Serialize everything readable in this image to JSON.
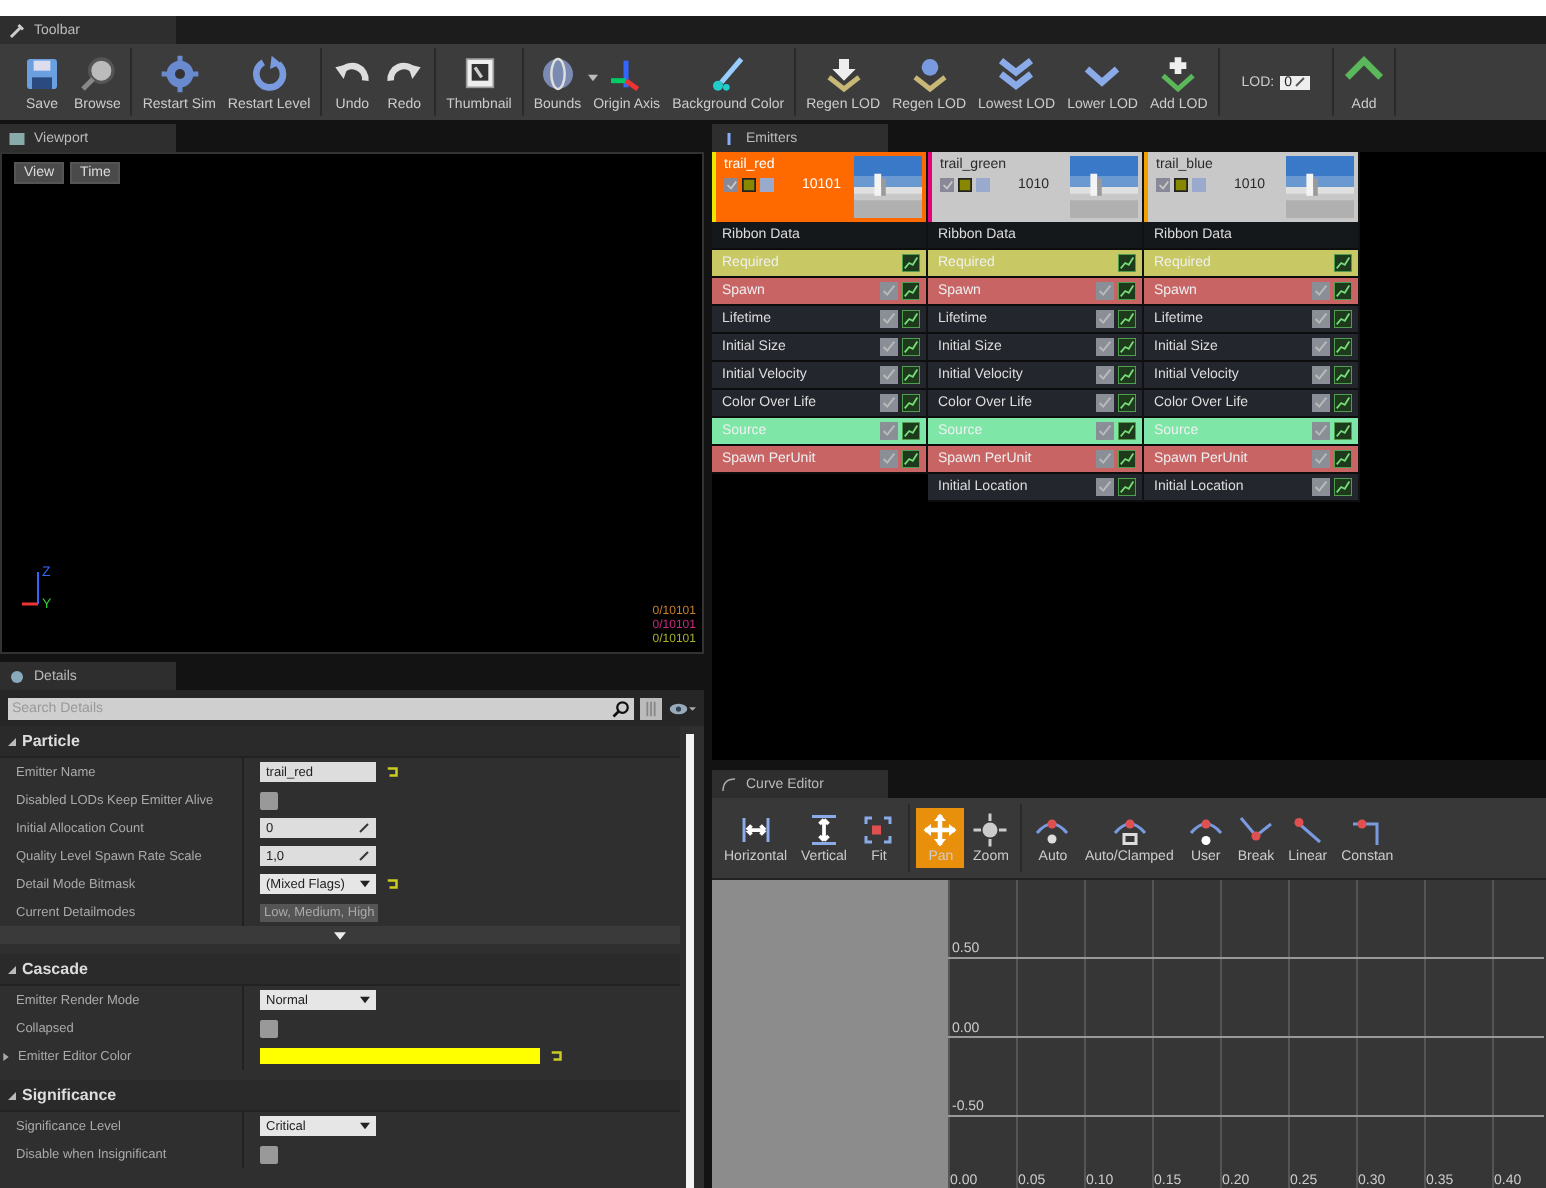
{
  "toolbar_tab": {
    "title": "Toolbar"
  },
  "toolbar": {
    "groups": [
      [
        {
          "label": "Save"
        },
        {
          "label": "Browse"
        }
      ],
      [
        {
          "label": "Restart Sim"
        },
        {
          "label": "Restart Level"
        }
      ],
      [
        {
          "label": "Undo"
        },
        {
          "label": "Redo"
        }
      ],
      [
        {
          "label": "Thumbnail"
        }
      ],
      [
        {
          "label": "Bounds",
          "dropdown": true
        },
        {
          "label": "Origin Axis"
        },
        {
          "label": "Background Color"
        }
      ],
      [
        {
          "label": "Regen LOD"
        },
        {
          "label": "Regen LOD"
        },
        {
          "label": "Lowest LOD"
        },
        {
          "label": "Lower LOD"
        },
        {
          "label": "Add LOD"
        }
      ],
      [
        {
          "label": "LOD:",
          "kind": "lod",
          "value": "0"
        }
      ],
      [
        {
          "label": "Add"
        }
      ]
    ]
  },
  "viewport": {
    "title": "Viewport",
    "buttons": [
      "View",
      "Time"
    ],
    "axis_labels": [
      "Z",
      "Y"
    ],
    "stats": [
      {
        "text": "0/10101",
        "color": "#c8802c"
      },
      {
        "text": "0/10101",
        "color": "#c82a84"
      },
      {
        "text": "0/10101",
        "color": "#a8b02a"
      }
    ]
  },
  "details": {
    "title": "Details",
    "search": {
      "placeholder": "Search Details"
    },
    "sections": [
      {
        "title": "Particle",
        "expanded": true,
        "advanced": true,
        "rows": [
          {
            "label": "Emitter Name",
            "kind": "text",
            "value": "trail_red",
            "reset": true
          },
          {
            "label": "Disabled LODs Keep Emitter Alive",
            "kind": "checkbox",
            "checked": false
          },
          {
            "label": "Initial Allocation Count",
            "kind": "number",
            "value": "0"
          },
          {
            "label": "Quality Level Spawn Rate Scale",
            "kind": "number",
            "value": "1,0"
          },
          {
            "label": "Detail Mode Bitmask",
            "kind": "dropdown",
            "value": "(Mixed Flags)",
            "reset": true
          },
          {
            "label": "Current Detailmodes",
            "kind": "readonly",
            "value": "Low, Medium, High"
          }
        ]
      },
      {
        "title": "Cascade",
        "expanded": true,
        "rows": [
          {
            "label": "Emitter Render Mode",
            "kind": "dropdown",
            "value": "Normal"
          },
          {
            "label": "Collapsed",
            "kind": "checkbox",
            "checked": false
          },
          {
            "label": "Emitter Editor Color",
            "kind": "color",
            "color": "#ffff00",
            "reset": true,
            "expandable": true
          }
        ]
      },
      {
        "title": "Significance",
        "expanded": true,
        "rows": [
          {
            "label": "Significance Level",
            "kind": "dropdown",
            "value": "Critical"
          },
          {
            "label": "Disable when Insignificant",
            "kind": "checkbox",
            "checked": false
          }
        ]
      }
    ]
  },
  "emitters": {
    "title": "Emitters",
    "columns": [
      {
        "name": "trail_red",
        "selected": true,
        "color": "#e8e800",
        "count": "10101",
        "modules": [
          {
            "label": "Ribbon Data",
            "kind": "typedata",
            "color": "#15181b"
          },
          {
            "label": "Required",
            "kind": "required",
            "color": "#c8c864"
          },
          {
            "label": "Spawn",
            "kind": "module",
            "color": "#c86464"
          },
          {
            "label": "Lifetime",
            "kind": "module",
            "color": "#24262d"
          },
          {
            "label": "Initial Size",
            "kind": "module",
            "color": "#24262d"
          },
          {
            "label": "Initial Velocity",
            "kind": "module",
            "color": "#24262d"
          },
          {
            "label": "Color Over Life",
            "kind": "module",
            "color": "#24262d"
          },
          {
            "label": "Source",
            "kind": "module",
            "color": "#7ee6a6"
          },
          {
            "label": "Spawn PerUnit",
            "kind": "module",
            "color": "#c86464"
          }
        ]
      },
      {
        "name": "trail_green",
        "selected": false,
        "color": "#e8007a",
        "count": "1010",
        "modules": [
          {
            "label": "Ribbon Data",
            "kind": "typedata",
            "color": "#15181b"
          },
          {
            "label": "Required",
            "kind": "required",
            "color": "#c8c864"
          },
          {
            "label": "Spawn",
            "kind": "module",
            "color": "#c86464"
          },
          {
            "label": "Lifetime",
            "kind": "module",
            "color": "#24262d"
          },
          {
            "label": "Initial Size",
            "kind": "module",
            "color": "#24262d"
          },
          {
            "label": "Initial Velocity",
            "kind": "module",
            "color": "#24262d"
          },
          {
            "label": "Color Over Life",
            "kind": "module",
            "color": "#24262d"
          },
          {
            "label": "Source",
            "kind": "module",
            "color": "#7ee6a6"
          },
          {
            "label": "Spawn PerUnit",
            "kind": "module",
            "color": "#c86464"
          },
          {
            "label": "Initial Location",
            "kind": "module",
            "color": "#24262d"
          }
        ]
      },
      {
        "name": "trail_blue",
        "selected": false,
        "color": "#f0a000",
        "count": "1010",
        "modules": [
          {
            "label": "Ribbon Data",
            "kind": "typedata",
            "color": "#15181b"
          },
          {
            "label": "Required",
            "kind": "required",
            "color": "#c8c864"
          },
          {
            "label": "Spawn",
            "kind": "module",
            "color": "#c86464"
          },
          {
            "label": "Lifetime",
            "kind": "module",
            "color": "#24262d"
          },
          {
            "label": "Initial Size",
            "kind": "module",
            "color": "#24262d"
          },
          {
            "label": "Initial Velocity",
            "kind": "module",
            "color": "#24262d"
          },
          {
            "label": "Color Over Life",
            "kind": "module",
            "color": "#24262d"
          },
          {
            "label": "Source",
            "kind": "module",
            "color": "#7ee6a6"
          },
          {
            "label": "Spawn PerUnit",
            "kind": "module",
            "color": "#c86464"
          },
          {
            "label": "Initial Location",
            "kind": "module",
            "color": "#24262d"
          }
        ]
      }
    ]
  },
  "curve_editor": {
    "title": "Curve Editor",
    "tools": [
      [
        {
          "label": "Horizontal",
          "selected": false
        },
        {
          "label": "Vertical",
          "selected": false
        },
        {
          "label": "Fit",
          "selected": false
        }
      ],
      [
        {
          "label": "Pan",
          "selected": true
        },
        {
          "label": "Zoom",
          "selected": false
        }
      ],
      [
        {
          "label": "Auto",
          "selected": false
        },
        {
          "label": "Auto/Clamped",
          "selected": false
        },
        {
          "label": "User",
          "selected": false
        },
        {
          "label": "Break",
          "selected": false
        },
        {
          "label": "Linear",
          "selected": false
        },
        {
          "label": "Constan",
          "selected": false
        }
      ]
    ],
    "y_labels": [
      "0.50",
      "0.00",
      "-0.50"
    ],
    "x_labels": [
      "0.00",
      "0.05",
      "0.10",
      "0.15",
      "0.20",
      "0.25",
      "0.30",
      "0.35",
      "0.40"
    ]
  }
}
